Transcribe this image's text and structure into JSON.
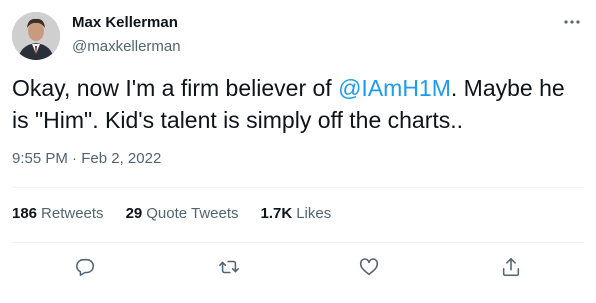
{
  "author": {
    "name": "Max Kellerman",
    "handle": "@maxkellerman"
  },
  "tweet": {
    "text_before": "Okay, now I'm a firm believer of ",
    "mention": "@IAmH1M",
    "text_after": ". Maybe he is \"Him\". Kid's talent is simply off the charts.."
  },
  "meta": {
    "time": "9:55 PM",
    "separator": "·",
    "date": "Feb 2, 2022"
  },
  "stats": {
    "retweets_count": "186",
    "retweets_label": "Retweets",
    "quotes_count": "29",
    "quotes_label": "Quote Tweets",
    "likes_count": "1.7K",
    "likes_label": "Likes"
  },
  "colors": {
    "accent": "#1d9bf0",
    "text_primary": "#0f1419",
    "text_secondary": "#536471",
    "divider": "#eff3f4"
  },
  "icons": [
    "avatar",
    "more-icon",
    "reply-icon",
    "retweet-icon",
    "like-icon",
    "share-icon"
  ]
}
